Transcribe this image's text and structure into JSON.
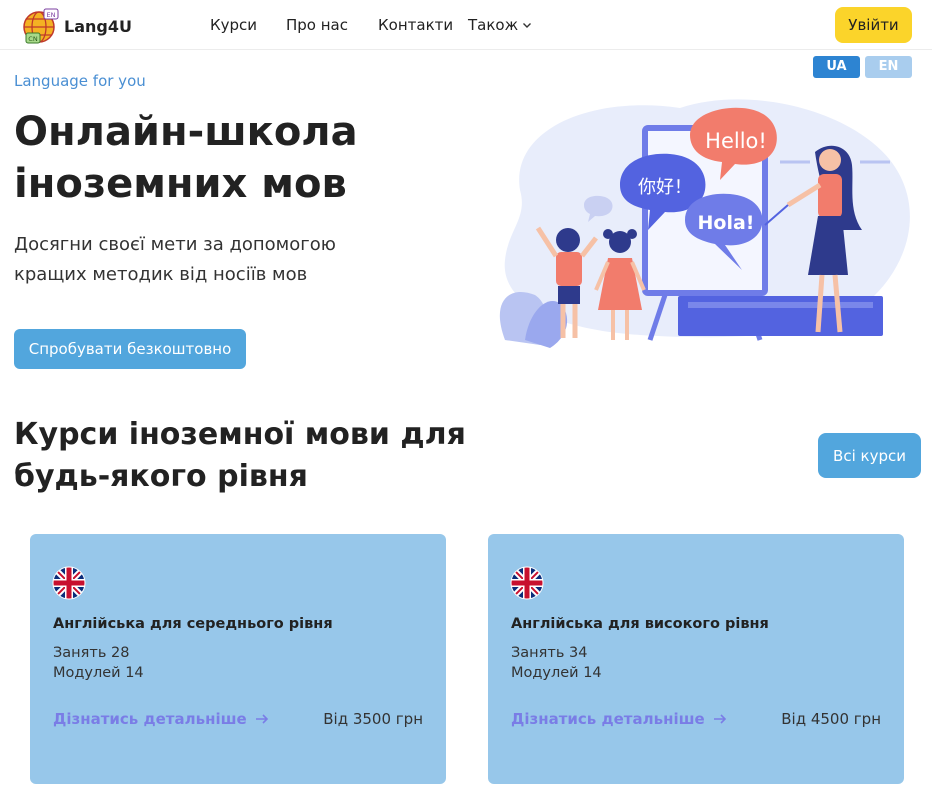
{
  "brand": {
    "name": "Lang4U",
    "logo_badge_top": "EN",
    "logo_badge_bottom": "CN"
  },
  "nav": {
    "items": [
      "Курси",
      "Про нас",
      "Контакти"
    ],
    "more_label": "Також",
    "login_label": "Увійти"
  },
  "languages": {
    "ua": "UA",
    "en": "EN"
  },
  "hero": {
    "tagline": "Language for you",
    "title_line1": "Онлайн-школа",
    "title_line2": "іноземних мов",
    "subtitle_line1": "Досягни своєї мети за допомогою",
    "subtitle_line2": "кращих методик від носіїв мов",
    "cta_label": "Спробувати безкоштовно",
    "bubbles": {
      "hello": "Hello!",
      "nihao": "你好！",
      "hola": "Hola!"
    }
  },
  "courses": {
    "title_line1": "Курси іноземної мови для",
    "title_line2": "будь-якого рівня",
    "all_label": "Всі курси",
    "items": [
      {
        "title": "Англійська для середнього рівня",
        "lessons": "Занять 28",
        "modules": "Модулей 14",
        "link": "Дізнатись детальніше",
        "price": "Від 3500 грн"
      },
      {
        "title": "Англійська для високого рівня",
        "lessons": "Занять 34",
        "modules": "Модулей 14",
        "link": "Дізнатись детальніше",
        "price": "Від 4500 грн"
      }
    ]
  },
  "colors": {
    "accent_blue": "#52a6dd",
    "login_yellow": "#fbd42a",
    "card_bg": "#97c7ea",
    "link_violet": "#7a7de6"
  }
}
